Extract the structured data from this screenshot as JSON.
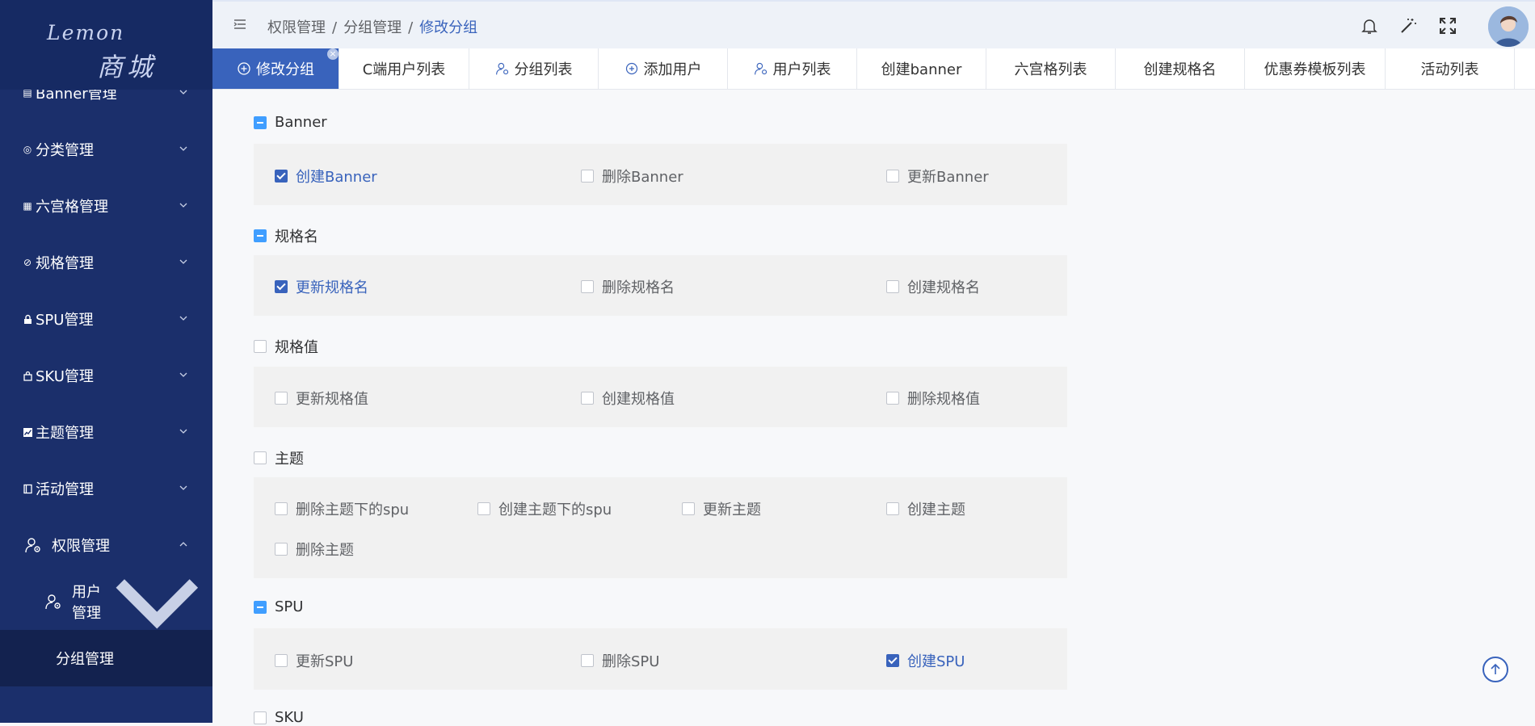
{
  "logo": {
    "line1": "Lemon",
    "line2": "商城"
  },
  "sidebar": {
    "items": [
      {
        "label": "Banner管理",
        "icon": "banner-icon",
        "glyph": "▤"
      },
      {
        "label": "分类管理",
        "icon": "category-icon",
        "glyph": "◎"
      },
      {
        "label": "六宫格管理",
        "icon": "grid-icon",
        "glyph": "▦"
      },
      {
        "label": "规格管理",
        "icon": "spec-icon",
        "glyph": "⊘"
      },
      {
        "label": "SPU管理",
        "icon": "lock-icon",
        "glyph": "🔒"
      },
      {
        "label": "SKU管理",
        "icon": "bag-icon",
        "glyph": "◻"
      },
      {
        "label": "主题管理",
        "icon": "chart-icon",
        "glyph": "▨"
      },
      {
        "label": "活动管理",
        "icon": "activity-icon",
        "glyph": "▯"
      },
      {
        "label": "权限管理",
        "icon": "user-gear-icon"
      },
      {
        "label": "用户管理",
        "icon": "user-gear-icon"
      },
      {
        "label": "分组管理"
      }
    ]
  },
  "breadcrumb": {
    "items": [
      "权限管理",
      "分组管理",
      "修改分组"
    ],
    "sep": "/"
  },
  "tabs": [
    {
      "label": "修改分组",
      "active": true,
      "close": "×"
    },
    {
      "label": "C端用户列表"
    },
    {
      "label": "分组列表"
    },
    {
      "label": "添加用户"
    },
    {
      "label": "用户列表"
    },
    {
      "label": "创建banner"
    },
    {
      "label": "六宫格列表"
    },
    {
      "label": "创建规格名"
    },
    {
      "label": "优惠券模板列表"
    },
    {
      "label": "活动列表"
    }
  ],
  "groups": [
    {
      "title": "Banner",
      "state": "indeterminate",
      "items": [
        {
          "label": "创建Banner",
          "checked": true
        },
        {
          "label": "删除Banner",
          "checked": false
        },
        {
          "label": "更新Banner",
          "checked": false
        }
      ]
    },
    {
      "title": "规格名",
      "state": "indeterminate",
      "items": [
        {
          "label": "更新规格名",
          "checked": true
        },
        {
          "label": "删除规格名",
          "checked": false
        },
        {
          "label": "创建规格名",
          "checked": false
        }
      ]
    },
    {
      "title": "规格值",
      "state": "unchecked",
      "items": [
        {
          "label": "更新规格值",
          "checked": false
        },
        {
          "label": "创建规格值",
          "checked": false
        },
        {
          "label": "删除规格值",
          "checked": false
        }
      ]
    },
    {
      "title": "主题",
      "state": "unchecked",
      "items": [
        {
          "label": "删除主题下的spu",
          "checked": false
        },
        {
          "label": "创建主题下的spu",
          "checked": false
        },
        {
          "label": "更新主题",
          "checked": false
        },
        {
          "label": "创建主题",
          "checked": false
        },
        {
          "label": "删除主题",
          "checked": false
        }
      ]
    },
    {
      "title": "SPU",
      "state": "indeterminate",
      "items": [
        {
          "label": "更新SPU",
          "checked": false
        },
        {
          "label": "删除SPU",
          "checked": false
        },
        {
          "label": "创建SPU",
          "checked": true
        }
      ]
    },
    {
      "title": "SKU",
      "state": "unchecked",
      "items": []
    }
  ],
  "colors": {
    "sidebar": "#1b2f6b",
    "accent": "#3963bc",
    "checkbox_indeterminate": "#409eff"
  }
}
